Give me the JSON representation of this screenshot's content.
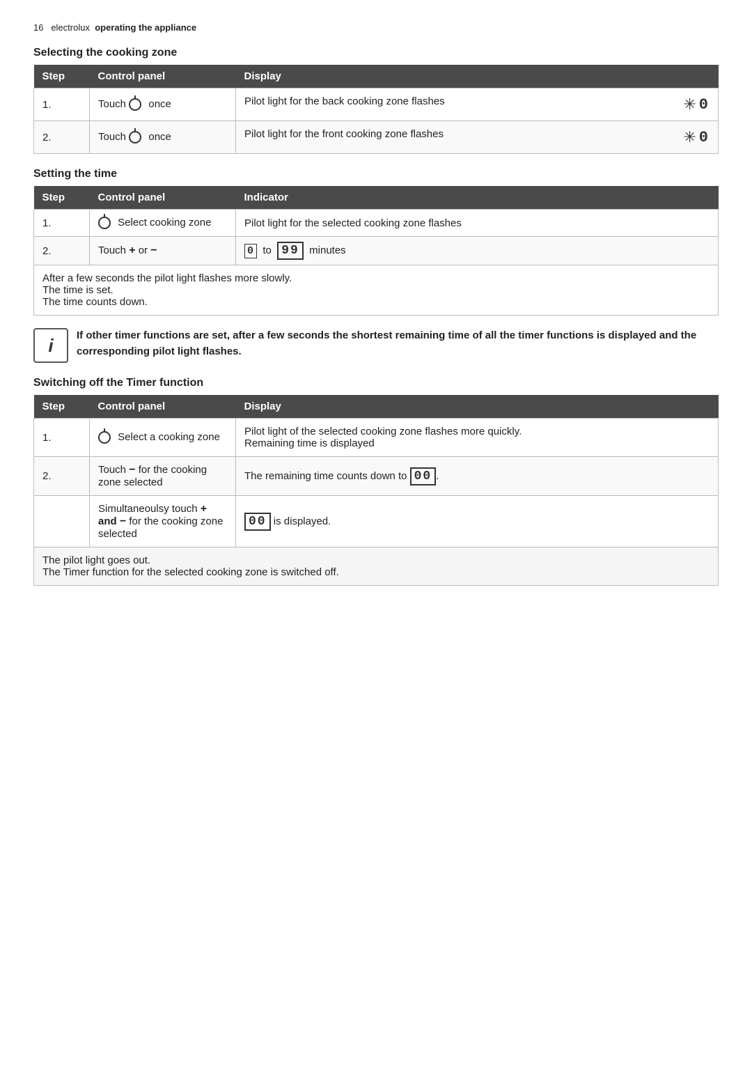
{
  "header": {
    "page_num": "16",
    "brand": "electrolux",
    "section": "operating the appliance"
  },
  "section1": {
    "title": "Selecting the cooking zone",
    "table": {
      "columns": [
        "Step",
        "Control panel",
        "Display"
      ],
      "rows": [
        {
          "step": "1.",
          "control": "Touch  once",
          "display": "Pilot light for the back cooking zone flashes"
        },
        {
          "step": "2.",
          "control": "Touch  once",
          "display": "Pilot light for the front cooking zone flashes"
        }
      ]
    }
  },
  "section2": {
    "title": "Setting the time",
    "table": {
      "columns": [
        "Step",
        "Control panel",
        "Indicator"
      ],
      "rows": [
        {
          "step": "1.",
          "control": "Select cooking zone",
          "indicator": "Pilot light for the selected cooking zone flashes"
        },
        {
          "step": "2.",
          "control": "Touch + or −",
          "indicator_prefix": "0 to",
          "indicator_value": "99",
          "indicator_suffix": "minutes"
        }
      ]
    },
    "note_lines": [
      "After a few seconds the pilot light flashes more slowly.",
      "The time is set.",
      "The time counts down."
    ]
  },
  "info_box": {
    "icon": "i",
    "text": "If other timer functions are set, after a few seconds the shortest remaining time of all the timer functions is displayed and the corresponding pilot light flashes."
  },
  "section3": {
    "title": "Switching off the Timer function",
    "table": {
      "columns": [
        "Step",
        "Control panel",
        "Display"
      ],
      "rows": [
        {
          "step": "1.",
          "control_icon": true,
          "control": "Select a cooking zone",
          "display": "Pilot light of the selected cooking zone flashes more quickly.\nRemaining time is displayed"
        },
        {
          "step": "2.",
          "control": "Touch − for the cooking zone selected",
          "display_prefix": "The remaining time counts down to",
          "display_value": "00"
        },
        {
          "step": "",
          "control_bold": "Simultaneoulsy touch + and − for the cooking zone selected",
          "display_value2": "00",
          "display_suffix": "is displayed."
        }
      ]
    },
    "footer_lines": [
      "The pilot light goes out.",
      "The Timer function for the selected cooking zone is switched off."
    ]
  }
}
